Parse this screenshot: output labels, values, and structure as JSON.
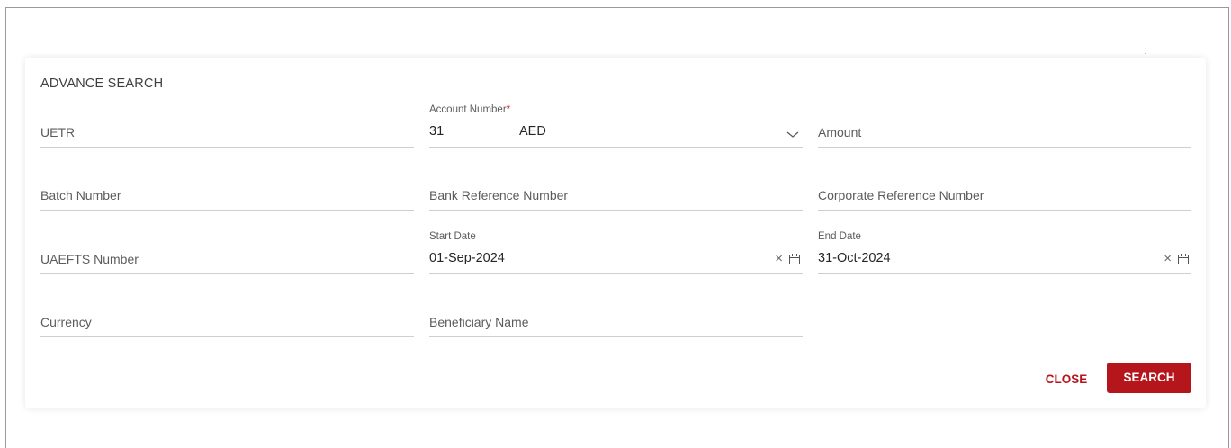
{
  "panel": {
    "title": "ADVANCE SEARCH"
  },
  "fields": {
    "uetr": {
      "label": "UETR"
    },
    "account_number": {
      "label": "Account Number",
      "required_mark": "*",
      "value_prefix": "31",
      "value_currency": "AED"
    },
    "amount": {
      "label": "Amount"
    },
    "batch_number": {
      "label": "Batch Number"
    },
    "bank_reference_number": {
      "label": "Bank Reference Number"
    },
    "corporate_reference_number": {
      "label": "Corporate Reference Number"
    },
    "uaefts_number": {
      "label": "UAEFTS Number"
    },
    "start_date": {
      "label": "Start Date",
      "value": "01-Sep-2024"
    },
    "end_date": {
      "label": "End Date",
      "value": "31-Oct-2024"
    },
    "currency": {
      "label": "Currency"
    },
    "beneficiary_name": {
      "label": "Beneficiary Name"
    }
  },
  "icons": {
    "dropdown": "chevron-down-icon",
    "clear": "close-icon",
    "calendar": "calendar-icon"
  },
  "clear_glyph": "×",
  "actions": {
    "close_label": "CLOSE",
    "search_label": "SEARCH"
  },
  "colors": {
    "accent": "#b5161c",
    "field_line": "#cfcfcf",
    "text": "#3a3a3a"
  }
}
